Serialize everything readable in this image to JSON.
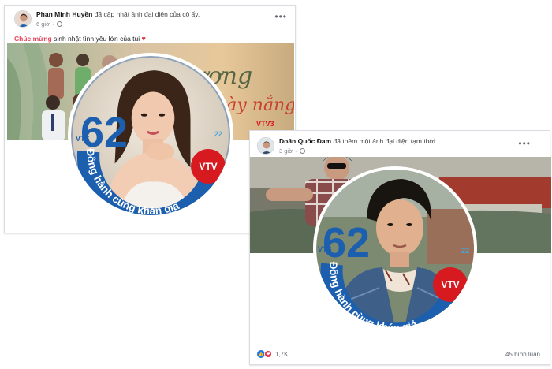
{
  "post1": {
    "author": "Phan Minh Huyền",
    "action": "đã cập nhật ảnh đại diện của cô ấy.",
    "time": "6 giờ",
    "caption_highlight": "Chúc mừng",
    "caption_text": "sinh nhật tình yêu lớn của tui",
    "heart": "♥",
    "cover_title": "Thương ngày nắng",
    "cover_logo": "VTV3"
  },
  "post2": {
    "author": "Doãn Quốc Đam",
    "action": "đã thêm một ảnh đại diện tạm thời.",
    "time": "3 giờ",
    "reaction_count": "1,7K",
    "comments": "45 bình luận"
  },
  "frame": {
    "number": "62",
    "small_label": "VTS",
    "slogan": "Đồng hành cùng khán giả",
    "logo": "VTV",
    "age": "22"
  },
  "menu_glyph": "•••",
  "colors": {
    "frame_blue": "#1b5fae",
    "vtv_red": "#d71920",
    "heart_red": "#e82d4a",
    "like_blue": "#1877f2"
  },
  "icons": [
    "globe-icon",
    "more-options-icon",
    "like-icon",
    "love-icon"
  ]
}
